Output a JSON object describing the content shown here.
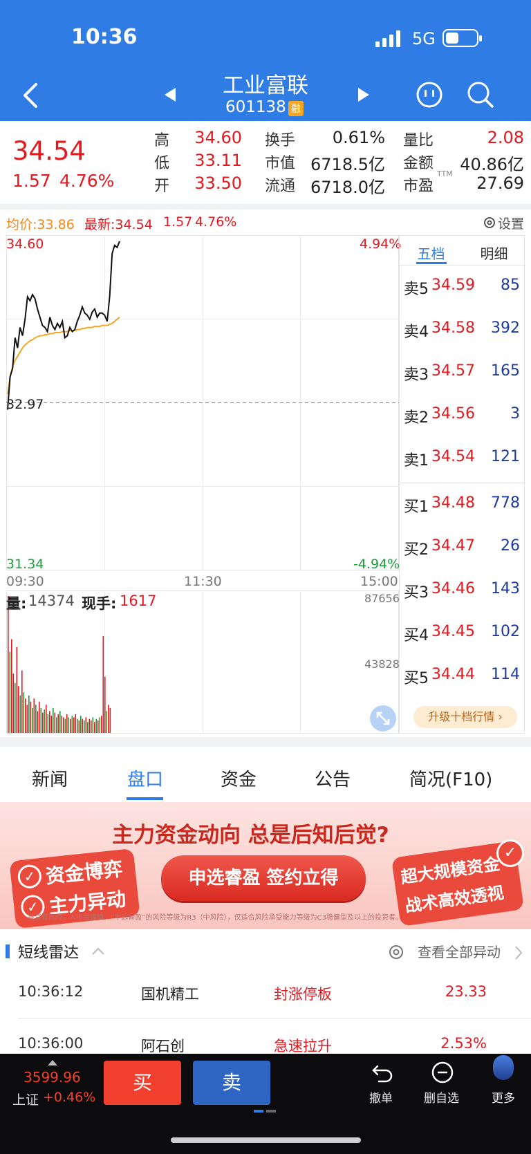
{
  "status_bar": {
    "time": "10:36",
    "network": "5G"
  },
  "header": {
    "name": "工业富联",
    "code": "601138",
    "badge": "融"
  },
  "quote": {
    "price": "34.54",
    "change": "1.57",
    "change_pct": "4.76%",
    "stats": [
      {
        "label": "高",
        "value": "34.60",
        "color": "red"
      },
      {
        "label": "换手",
        "value": "0.61%",
        "color": "dark"
      },
      {
        "label": "量比",
        "value": "2.08",
        "color": "red"
      },
      {
        "label": "低",
        "value": "33.11",
        "color": "red"
      },
      {
        "label": "市值",
        "value": "6718.5亿",
        "color": "dark"
      },
      {
        "label": "金额",
        "value": "40.86亿",
        "color": "dark"
      },
      {
        "label": "开",
        "value": "33.50",
        "color": "red"
      },
      {
        "label": "流通",
        "value": "6718.0亿",
        "color": "dark"
      },
      {
        "label": "市盈",
        "value": "27.69",
        "color": "dark",
        "sup": "TTM"
      }
    ]
  },
  "chart_bar": {
    "avg_label": "均价:33.86",
    "latest_label": "最新:34.54",
    "latest_change": "1.57",
    "latest_pct": "4.76%",
    "settings": "设置"
  },
  "chart_data": {
    "type": "line",
    "y_top_label": "34.60",
    "y_top_pct": "4.94%",
    "y_mid_label": "32.97",
    "y_bottom_label": "31.34",
    "y_bottom_pct": "-4.94%",
    "x_labels": [
      "09:30",
      "11:30",
      "15:00"
    ],
    "ylim": [
      31.34,
      34.6
    ],
    "price": [
      32.9,
      33.22,
      33.3,
      33.6,
      33.5,
      33.7,
      33.62,
      33.78,
      34.0,
      33.96,
      34.02,
      33.98,
      33.88,
      33.8,
      33.72,
      33.7,
      33.66,
      33.8,
      33.72,
      33.68,
      33.74,
      33.7,
      33.76,
      33.6,
      33.62,
      33.7,
      33.66,
      33.68,
      33.76,
      33.82,
      33.9,
      33.84,
      33.82,
      33.78,
      33.85,
      33.88,
      33.8,
      33.84,
      33.84,
      33.82,
      33.76,
      34.0,
      34.42,
      34.5,
      34.48,
      34.54
    ],
    "avg": [
      33.05,
      33.22,
      33.32,
      33.38,
      33.42,
      33.46,
      33.5,
      33.53,
      33.55,
      33.57,
      33.58,
      33.6,
      33.61,
      33.62,
      33.62,
      33.63,
      33.63,
      33.64,
      33.64,
      33.65,
      33.65,
      33.65,
      33.66,
      33.66,
      33.66,
      33.67,
      33.67,
      33.67,
      33.68,
      33.68,
      33.69,
      33.69,
      33.7,
      33.7,
      33.7,
      33.71,
      33.71,
      33.71,
      33.72,
      33.72,
      33.72,
      33.73,
      33.74,
      33.76,
      33.78,
      33.8
    ],
    "volume_header": {
      "label": "量:",
      "value": "14374",
      "hand_label": "现手:",
      "hand_value": "1617"
    },
    "volume_max_label": "87656",
    "volume_mid_label": "43828",
    "volume_max": 87656,
    "volumes": [
      87656,
      52000,
      60000,
      38000,
      32000,
      55000,
      30000,
      24000,
      40000,
      26000,
      22000,
      18000,
      24000,
      20000,
      16000,
      22000,
      18000,
      14000,
      20000,
      16000,
      13000,
      15000,
      18000,
      12000,
      14000,
      11000,
      16000,
      13000,
      10000,
      12000,
      14000,
      11000,
      10000,
      9000,
      12000,
      10000,
      9000,
      11000,
      10000,
      12000,
      9000,
      8000,
      11000,
      9000,
      8000,
      10000,
      7000,
      9000,
      8000,
      10000,
      7000,
      9000,
      8000,
      10000,
      11000,
      62000,
      36000,
      14000,
      18000,
      16000
    ],
    "volume_colors": [
      "r",
      "g",
      "r",
      "r",
      "g",
      "r",
      "r",
      "g",
      "r",
      "g",
      "r",
      "r",
      "g",
      "r",
      "g",
      "r",
      "g",
      "r",
      "r",
      "g",
      "r",
      "g",
      "r",
      "g",
      "r",
      "r",
      "g",
      "r",
      "g",
      "r",
      "g",
      "r",
      "r",
      "g",
      "r",
      "g",
      "r",
      "g",
      "r",
      "r",
      "g",
      "r",
      "g",
      "r",
      "g",
      "r",
      "g",
      "r",
      "r",
      "g",
      "r",
      "g",
      "r",
      "g",
      "r",
      "r",
      "r",
      "g",
      "r",
      "r"
    ]
  },
  "dangwei": {
    "tabs": [
      "五档",
      "明细"
    ],
    "sell": [
      {
        "label": "卖5",
        "price": "34.59",
        "vol": "85"
      },
      {
        "label": "卖4",
        "price": "34.58",
        "vol": "392"
      },
      {
        "label": "卖3",
        "price": "34.57",
        "vol": "165"
      },
      {
        "label": "卖2",
        "price": "34.56",
        "vol": "3"
      },
      {
        "label": "卖1",
        "price": "34.54",
        "vol": "121"
      }
    ],
    "buy": [
      {
        "label": "买1",
        "price": "34.48",
        "vol": "778"
      },
      {
        "label": "买2",
        "price": "34.47",
        "vol": "26"
      },
      {
        "label": "买3",
        "price": "34.46",
        "vol": "143"
      },
      {
        "label": "买4",
        "price": "34.45",
        "vol": "102"
      },
      {
        "label": "买5",
        "price": "34.44",
        "vol": "114"
      }
    ],
    "upgrade": "升级十档行情"
  },
  "tabs": [
    "新闻",
    "盘口",
    "资金",
    "公告",
    "简况(F10)"
  ],
  "banner": {
    "headline": "主力资金动向 总是后知后觉?",
    "left_line1": "资金博弈",
    "left_line2": "主力异动",
    "button": "申选睿盈 签约立得",
    "right_line1": "超大规模资金",
    "right_line2": "战术高效透视",
    "disclaimer": "投资有风险，入市需谨慎。“申选睿盈”的风险等级为R3（中风险），仅适合风险承受能力等级为C3稳健型及以上的投资者。"
  },
  "radar": {
    "title": "短线雷达",
    "view_all": "查看全部异动",
    "rows": [
      {
        "time": "10:36:12",
        "name": "国机精工",
        "event": "封涨停板",
        "value": "23.33"
      },
      {
        "time": "10:36:00",
        "name": "阿石创",
        "event": "急速拉升",
        "value": "2.53%"
      }
    ]
  },
  "bottom": {
    "index_value": "3599.96",
    "index_name": "上证",
    "index_change": "+0.46%",
    "buy": "买",
    "sell": "卖",
    "actions": [
      {
        "label": "撤单",
        "icon": "undo-icon"
      },
      {
        "label": "删自选",
        "icon": "minus-circle-icon"
      },
      {
        "label": "更多",
        "icon": "more-icon"
      }
    ]
  },
  "colors": {
    "header_bg": "#2f7ce4",
    "up": "#e4181f",
    "down": "#1c9b3c",
    "buy_btn": "#f2402f",
    "sell_btn": "#2f66c4"
  }
}
